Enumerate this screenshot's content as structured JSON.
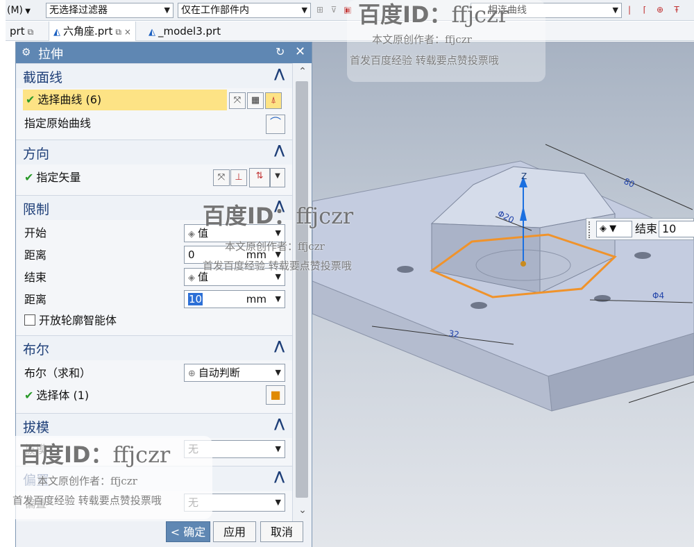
{
  "toolbar": {
    "menu": "(M)",
    "filter": "无选择过滤器",
    "scope": "仅在工作部件内",
    "curve_rule": "相连曲线"
  },
  "tabs": [
    {
      "label": "prt"
    },
    {
      "label": "六角座.prt"
    },
    {
      "label": "_model3.prt"
    }
  ],
  "dialog": {
    "title": "拉伸",
    "sections": {
      "section_curve": {
        "title": "截面线",
        "select_curve": "选择曲线 (6)",
        "origin_curve": "指定原始曲线"
      },
      "direction": {
        "title": "方向",
        "vector": "指定矢量"
      },
      "limits": {
        "title": "限制",
        "start_label": "开始",
        "start_value": "值",
        "distance_label": "距离",
        "start_distance": "0",
        "unit": "mm",
        "end_label": "结束",
        "end_value": "值",
        "end_distance": "10",
        "open_profile": "开放轮廓智能体"
      },
      "boolean": {
        "title": "布尔",
        "boolean_label": "布尔（求和）",
        "boolean_value": "自动判断",
        "select_body": "选择体 (1)"
      },
      "draft": {
        "title": "拔模",
        "draft_label": "拔模",
        "draft_value": "无"
      },
      "offset": {
        "title": "偏置",
        "offset_label": "偏置",
        "offset_value": "无"
      }
    },
    "buttons": {
      "ok": "< 确定 >",
      "apply": "应用",
      "cancel": "取消"
    }
  },
  "viewport": {
    "end_popup": {
      "label": "结束",
      "value": "10"
    },
    "axis_label": "Z",
    "dims": [
      "80",
      "Φ20",
      "Φ4",
      "32"
    ],
    "colors": {
      "solid": "#c4cce0",
      "hex_outline": "#f0932b",
      "axis": "#1a6fe0"
    }
  },
  "watermarks": {
    "brand": "百度ID：",
    "user": "ffjczr",
    "author": "本文原创作者：ffjczr",
    "notice": "首发百度经验 转载要点赞投票哦"
  }
}
